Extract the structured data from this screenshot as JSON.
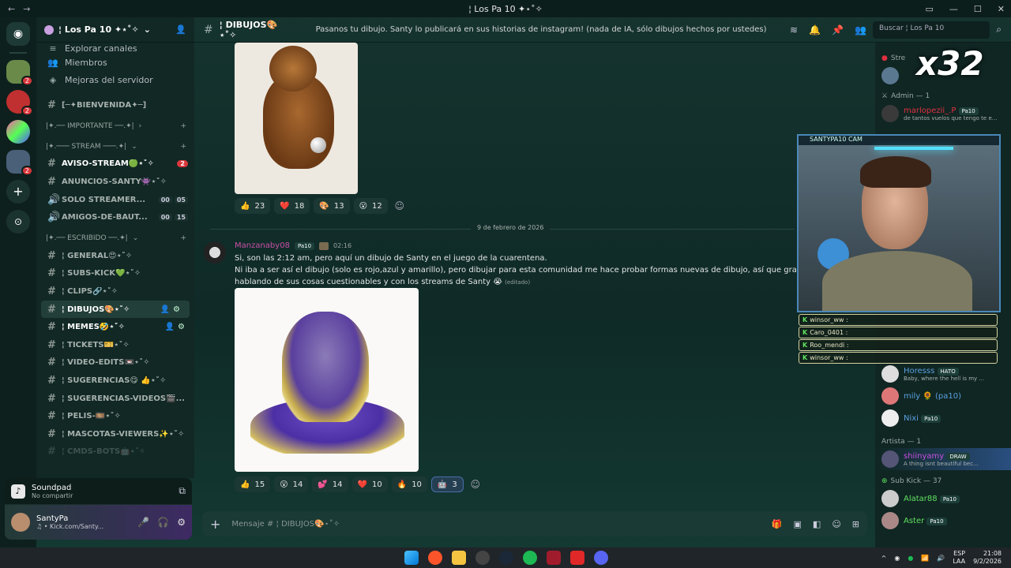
{
  "window": {
    "title": "¦ Los Pa 10 ✦⋆˚✧"
  },
  "server": {
    "name": "¦ Los Pa 10 ✦⋆˚✧"
  },
  "sidebar_top": [
    {
      "label": "Explorar canales"
    },
    {
      "label": "Miembros"
    },
    {
      "label": "Mejoras del servidor"
    }
  ],
  "welcome_channel": "[─✦BIENVENIDA✦─]",
  "categories": {
    "importante": "|✦.── IMPORTANTE ──.✦|",
    "stream": "|✦.─── STREAM ───.✦|",
    "escribido": "|✦.── ESCRIBIDO ──.✦|"
  },
  "channels": [
    {
      "name": "AVISO-STREAM🟢⋆˚✧",
      "badge": "2"
    },
    {
      "name": "ANUNCIOS-SANTY👾⋆˚✧"
    },
    {
      "name": "SOLO STREAMER...",
      "c1": "00",
      "c2": "05"
    },
    {
      "name": "AMIGOS-DE-BAUT...",
      "c1": "00",
      "c2": "15"
    }
  ],
  "channels2": [
    {
      "name": "¦ GENERAL😍⋆˚✧"
    },
    {
      "name": "¦ SUBS-KICK💚⋆˚✧"
    },
    {
      "name": "¦ CLIPS🔗⋆˚✧"
    },
    {
      "name": "¦ DIBUJOS🎨⋆˚✧"
    },
    {
      "name": "¦ MEMES🤣⋆˚✧"
    },
    {
      "name": "¦ TICKETS🎫⋆˚✧"
    },
    {
      "name": "¦ VIDEO-EDITS📼⋆˚✧"
    },
    {
      "name": "¦ SUGERENCIAS😋 👍⋆˚✧"
    },
    {
      "name": "¦ SUGERENCIAS-VIDEOS🎬..."
    },
    {
      "name": "¦ PELIS-🎞️⋆˚✧"
    },
    {
      "name": "¦ MASCOTAS-VIEWERS✨⋆˚✧"
    },
    {
      "name": "¦ CMDS-BOTS🤖⋆˚✧"
    }
  ],
  "soundpad": {
    "title": "Soundpad",
    "sub": "No compartir"
  },
  "user": {
    "name": "SantyPa",
    "status": "♫ • Kick.com/Santy..."
  },
  "topbar": {
    "channel": "¦ DIBUJOS🎨⋆˚✧",
    "topic": "Pasanos tu dibujo. Santy lo publicará en sus historias de instagram! (nada de IA, sólo dibujos hechos por ustedes)",
    "search": "Buscar  ¦ Los Pa 10"
  },
  "reactions1": [
    {
      "emoji": "👍",
      "count": "23"
    },
    {
      "emoji": "❤️",
      "count": "18"
    },
    {
      "emoji": "🎨",
      "count": "13"
    },
    {
      "emoji": "😮",
      "count": "12"
    }
  ],
  "date_divider": "9 de febrero de 2026",
  "message": {
    "author": "Manzanaby08",
    "tag": "Pa10",
    "time": "02:16",
    "line1": "Si, son las 2:12 am, pero aquí un dibujo de Santy en el juego de la cuarentena.",
    "line2": "Ni iba a ser así el dibujo (solo es rojo,azul y amarillo), pero dibujar para esta comunidad me hace probar formas nuevas de dibujo, así que gracias por levantarm",
    "line3": "hablando de sus cosas cuestionables y con los streams de Santy 😭",
    "edited": "(editado)"
  },
  "reactions2": [
    {
      "emoji": "👍",
      "count": "15"
    },
    {
      "emoji": "😮",
      "count": "14"
    },
    {
      "emoji": "💕",
      "count": "14"
    },
    {
      "emoji": "❤️",
      "count": "10"
    },
    {
      "emoji": "🔥",
      "count": "10"
    },
    {
      "emoji": "🤖",
      "count": "3"
    }
  ],
  "composer": {
    "placeholder": "Mensaje # ¦ DIBUJOS🎨⋆˚✧"
  },
  "members": {
    "streamer_cat": "Stre",
    "admin_cat": "Admin — 1",
    "admin": {
      "name": "marlopezii_.P",
      "tag": "Pa10",
      "sub": "de tantos vuelos que tengo te e..."
    },
    "row_horesss": {
      "name": "Horesss",
      "tag": "HATO",
      "sub": "Baby, where the hell is my ..."
    },
    "row_mily": {
      "name": "mily 🌻 (pa10)"
    },
    "row_nixi": {
      "name": "Nixi",
      "tag": "Pa10"
    },
    "artista_cat": "Artista — 1",
    "artista": {
      "name": "shiinyamy",
      "tag": "DRAW",
      "sub": "A thing isnt beautiful bec..."
    },
    "subkick_cat": "Sub Kick — 37",
    "alatar": {
      "name": "Alatar88",
      "tag": "Pa10"
    },
    "aster": {
      "name": "Aster",
      "tag": "Pa10"
    }
  },
  "cam": {
    "title": "SANTYPA10 CAM"
  },
  "chat_overlay": [
    {
      "user": "winsor_ww :"
    },
    {
      "user": "Caro_0401 :"
    },
    {
      "user": "Roo_mendi :"
    },
    {
      "user": "winsor_ww :"
    }
  ],
  "overlay_text": "x32",
  "taskbar": {
    "lang": "ESP\nLAA",
    "time": "21:08",
    "date": "9/2/2026"
  }
}
